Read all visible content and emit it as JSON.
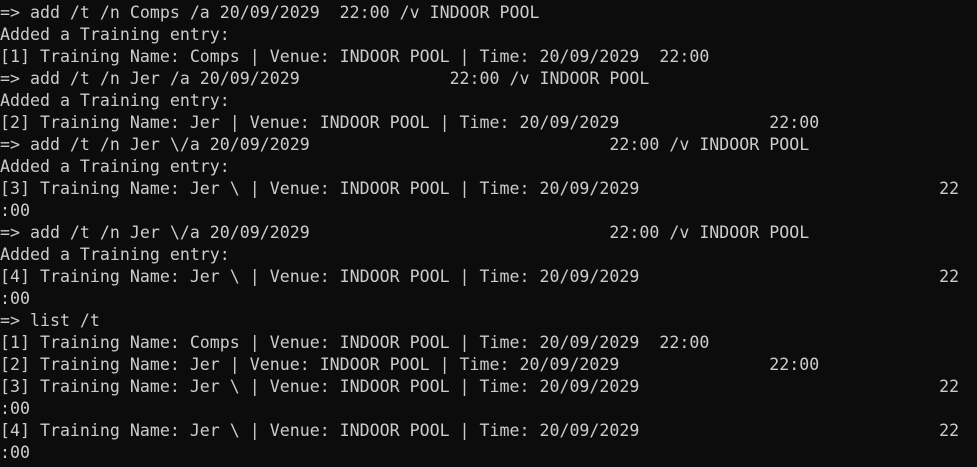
{
  "terminal": {
    "lines": [
      "=> add /t /n Comps /a 20/09/2029  22:00 /v INDOOR POOL",
      "Added a Training entry:",
      "[1] Training Name: Comps | Venue: INDOOR POOL | Time: 20/09/2029  22:00",
      "=> add /t /n Jer /a 20/09/2029               22:00 /v INDOOR POOL",
      "Added a Training entry:",
      "[2] Training Name: Jer | Venue: INDOOR POOL | Time: 20/09/2029               22:00",
      "=> add /t /n Jer \\/a 20/09/2029                              22:00 /v INDOOR POOL",
      "Added a Training entry:",
      "[3] Training Name: Jer \\ | Venue: INDOOR POOL | Time: 20/09/2029                              22",
      ":00",
      "=> add /t /n Jer \\/a 20/09/2029                              22:00 /v INDOOR POOL",
      "Added a Training entry:",
      "[4] Training Name: Jer \\ | Venue: INDOOR POOL | Time: 20/09/2029                              22",
      ":00",
      "=> list /t",
      "[1] Training Name: Comps | Venue: INDOOR POOL | Time: 20/09/2029  22:00",
      "[2] Training Name: Jer | Venue: INDOOR POOL | Time: 20/09/2029               22:00",
      "[3] Training Name: Jer \\ | Venue: INDOOR POOL | Time: 20/09/2029                              22",
      ":00",
      "[4] Training Name: Jer \\ | Venue: INDOOR POOL | Time: 20/09/2029                              22",
      ":00"
    ]
  },
  "colors": {
    "background": "#0c0c0c",
    "text": "#cccccc"
  }
}
